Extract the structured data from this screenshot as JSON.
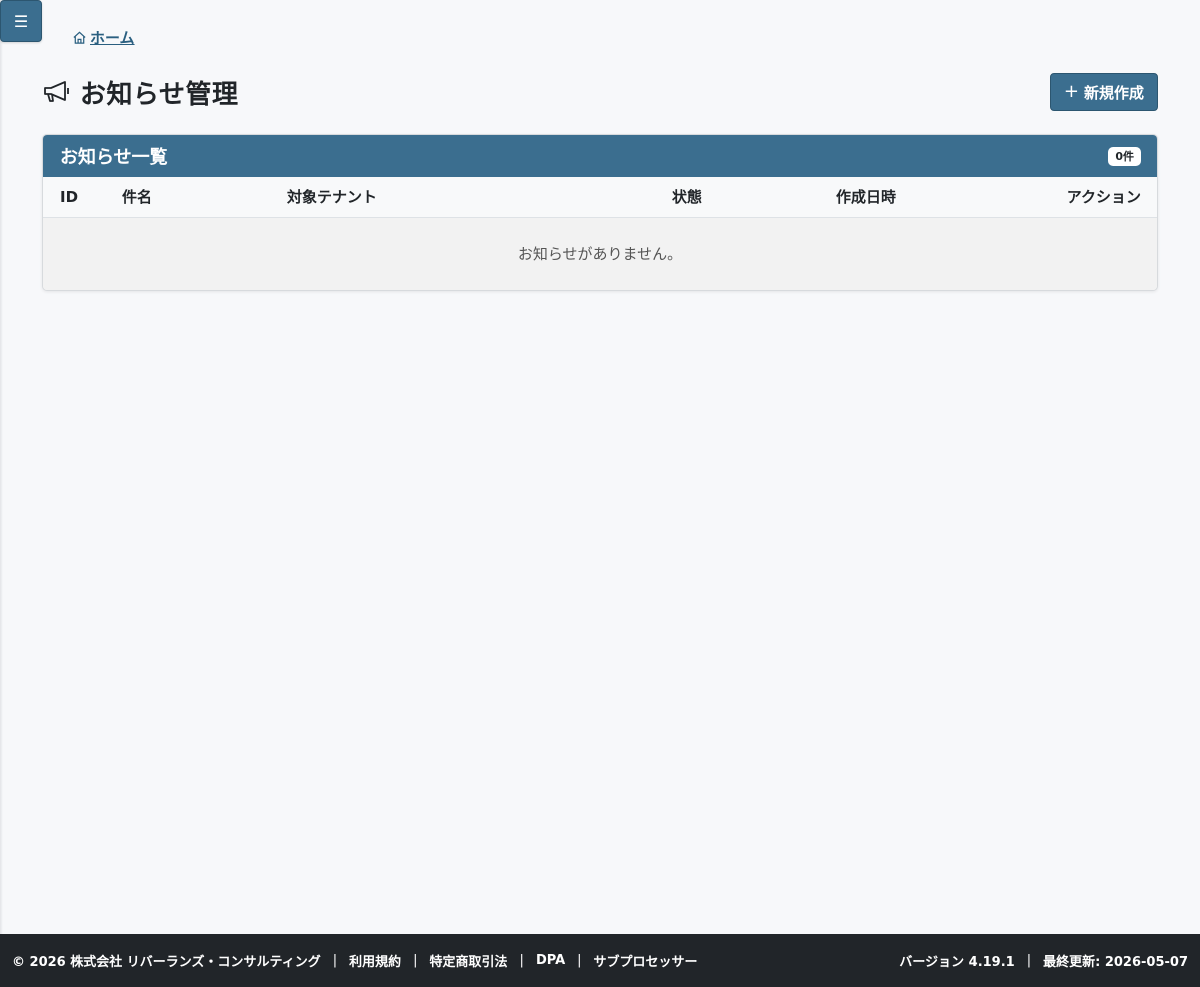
{
  "nav": {
    "menu_icon": "☰",
    "menu_icon_name": "hamburger-menu-icon"
  },
  "breadcrumb": {
    "home_label": "ホーム",
    "home_icon": "house-icon"
  },
  "header": {
    "title": "お知らせ管理",
    "title_icon": "megaphone-icon",
    "new_button_plus": "+",
    "new_button_label": "新規作成"
  },
  "card": {
    "title": "お知らせ一覧",
    "count_badge": "0件",
    "columns": [
      "ID",
      "件名",
      "対象テナント",
      "状態",
      "作成日時",
      "アクション"
    ],
    "empty_message": "お知らせがありません。"
  },
  "footer": {
    "copyright": "© 2026 株式会社 リバーランズ・コンサルティング",
    "links": [
      "利用規約",
      "特定商取引法",
      "DPA",
      "サブプロセッサー"
    ],
    "separator": "|",
    "version": "バージョン 4.19.1",
    "last_updated": "最終更新: 2026-05-07"
  },
  "colors": {
    "primary": "#3b6e8f",
    "footer_bg": "#212529",
    "page_bg": "#f7f8fa",
    "link": "#2a5f80"
  }
}
